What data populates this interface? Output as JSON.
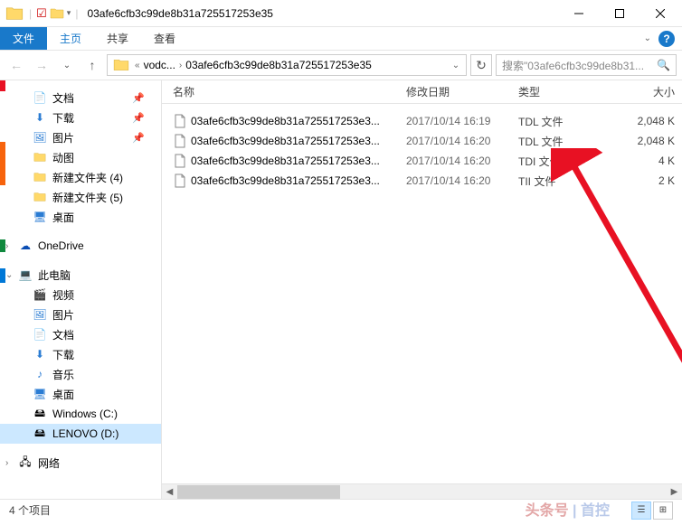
{
  "titlebar": {
    "title": "03afe6cfb3c99de8b31a725517253e35"
  },
  "ribbon": {
    "file": "文件",
    "home": "主页",
    "share": "共享",
    "view": "查看"
  },
  "navbar": {
    "seg1": "vodc...",
    "seg2": "03afe6cfb3c99de8b31a725517253e35",
    "search_placeholder": "搜索\"03afe6cfb3c99de8b31..."
  },
  "sidebar": {
    "docs": "文档",
    "downloads": "下载",
    "pictures": "图片",
    "dongtu": "动图",
    "newfolder4": "新建文件夹 (4)",
    "newfolder5": "新建文件夹 (5)",
    "desktop": "桌面",
    "onedrive": "OneDrive",
    "thispc": "此电脑",
    "videos": "视频",
    "pictures2": "图片",
    "docs2": "文档",
    "downloads2": "下载",
    "music": "音乐",
    "desktop2": "桌面",
    "windowsc": "Windows (C:)",
    "lenovod": "LENOVO (D:)",
    "network": "网络"
  },
  "columns": {
    "name": "名称",
    "date": "修改日期",
    "type": "类型",
    "size": "大小"
  },
  "files": [
    {
      "name": "03afe6cfb3c99de8b31a725517253e3...",
      "date": "2017/10/14 16:19",
      "type": "TDL 文件",
      "size": "2,048 K"
    },
    {
      "name": "03afe6cfb3c99de8b31a725517253e3...",
      "date": "2017/10/14 16:20",
      "type": "TDL 文件",
      "size": "2,048 K"
    },
    {
      "name": "03afe6cfb3c99de8b31a725517253e3...",
      "date": "2017/10/14 16:20",
      "type": "TDI 文件",
      "size": "4 K"
    },
    {
      "name": "03afe6cfb3c99de8b31a725517253e3...",
      "date": "2017/10/14 16:20",
      "type": "TII 文件",
      "size": "2 K"
    }
  ],
  "status": {
    "count": "4 个项目"
  },
  "watermark": {
    "left": "头条号",
    "right": "首控"
  }
}
